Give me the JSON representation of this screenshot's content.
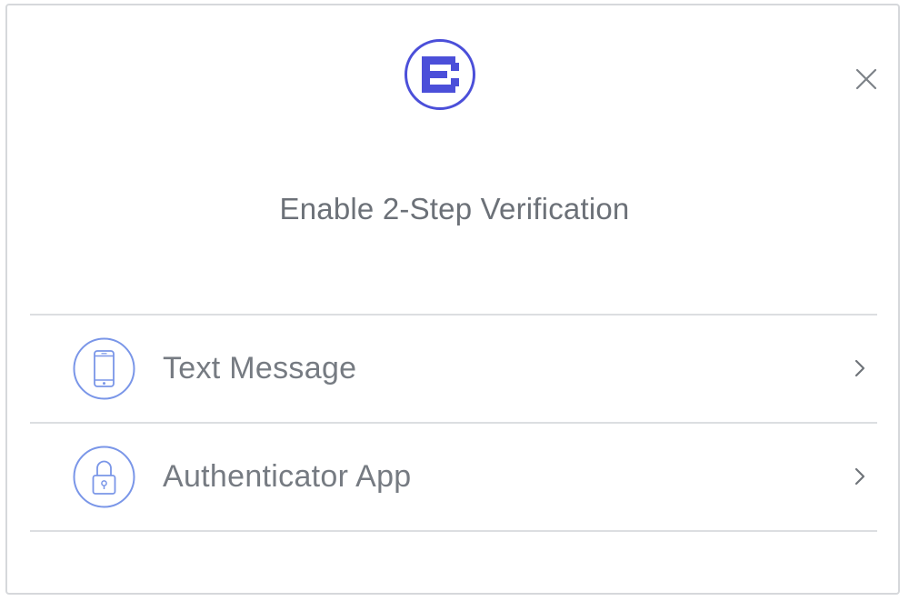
{
  "dialog": {
    "logo_icon": "brand-e-logo",
    "close_icon": "close-x-icon",
    "title": "Enable 2-Step Verification",
    "brand_color": "#4b4fd9",
    "icon_color": "#7a96e8"
  },
  "options": [
    {
      "label": "Text Message",
      "icon": "smartphone-icon",
      "chevron": "chevron-right-icon"
    },
    {
      "label": "Authenticator App",
      "icon": "lock-icon",
      "chevron": "chevron-right-icon"
    }
  ]
}
